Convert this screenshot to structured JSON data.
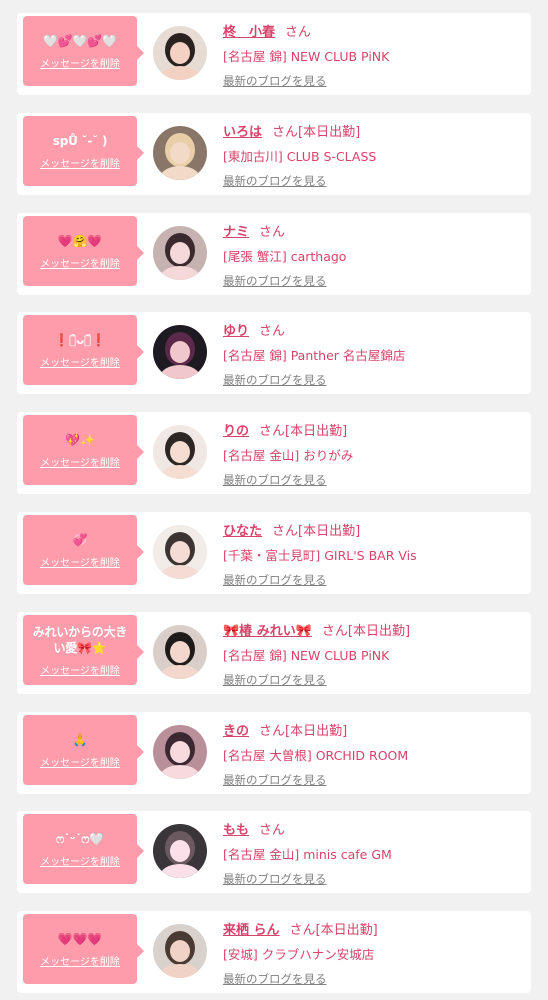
{
  "cards": [
    {
      "message": "🤍💕🤍💕🤍",
      "delete_label": "メッセージを削除",
      "name": "柊　小春",
      "suffix": "さん",
      "shop": "[名古屋 錦] NEW CLUB PiNK",
      "blog_link": "最新のブログを見る"
    },
    {
      "message": "spŮ ˘-˘ )",
      "delete_label": "メッセージを削除",
      "name": "いろは",
      "suffix": "さん[本日出勤]",
      "shop": "[東加古川] CLUB S-CLASS",
      "blog_link": "最新のブログを見る"
    },
    {
      "message": "💗🤗💗",
      "delete_label": "メッセージを削除",
      "name": "ナミ",
      "suffix": "さん",
      "shop": "[尾張 蟹江] carthago",
      "blog_link": "最新のブログを見る"
    },
    {
      "message": "❗️ꈍ̑ᴗꈍ̑❗️",
      "delete_label": "メッセージを削除",
      "name": "ゆり",
      "suffix": "さん",
      "shop": "[名古屋 錦] Panther 名古屋錦店",
      "blog_link": "最新のブログを見る"
    },
    {
      "message": "💖✨",
      "delete_label": "メッセージを削除",
      "name": "りの",
      "suffix": "さん[本日出勤]",
      "shop": "[名古屋 金山] おりがみ",
      "blog_link": "最新のブログを見る"
    },
    {
      "message": "💞",
      "delete_label": "メッセージを削除",
      "name": "ひなた",
      "suffix": "さん[本日出勤]",
      "shop": "[千葉・富士見町] GIRL'S BAR Vis",
      "blog_link": "最新のブログを見る"
    },
    {
      "message": "みれいからの大きい愛🎀⭐️",
      "delete_label": "メッセージを削除",
      "name": "🎀椿 みれい🎀",
      "suffix": "さん[本日出勤]",
      "shop": "[名古屋 錦] NEW CLUB PiNK",
      "blog_link": "最新のブログを見る"
    },
    {
      "message": "🙏",
      "delete_label": "メッセージを削除",
      "name": "きの",
      "suffix": "さん[本日出勤]",
      "shop": "[名古屋 大曽根] ORCHID ROOM",
      "blog_link": "最新のブログを見る"
    },
    {
      "message": "ෆ˙ᵕ˙ෆ🤍",
      "delete_label": "メッセージを削除",
      "name": "もも",
      "suffix": "さん",
      "shop": "[名古屋 金山] minis cafe GM",
      "blog_link": "最新のブログを見る"
    },
    {
      "message": "💗💗💗",
      "delete_label": "メッセージを削除",
      "name": "来栖 らん",
      "suffix": "さん[本日出勤]",
      "shop": "[安城] クラブハナン安城店",
      "blog_link": "最新のブログを見る"
    }
  ],
  "colors": {
    "accent": "#d8436b",
    "bubble": "#ff9cab",
    "link_gray": "#808080",
    "background": "#f1f1f1",
    "card": "#ffffff"
  }
}
